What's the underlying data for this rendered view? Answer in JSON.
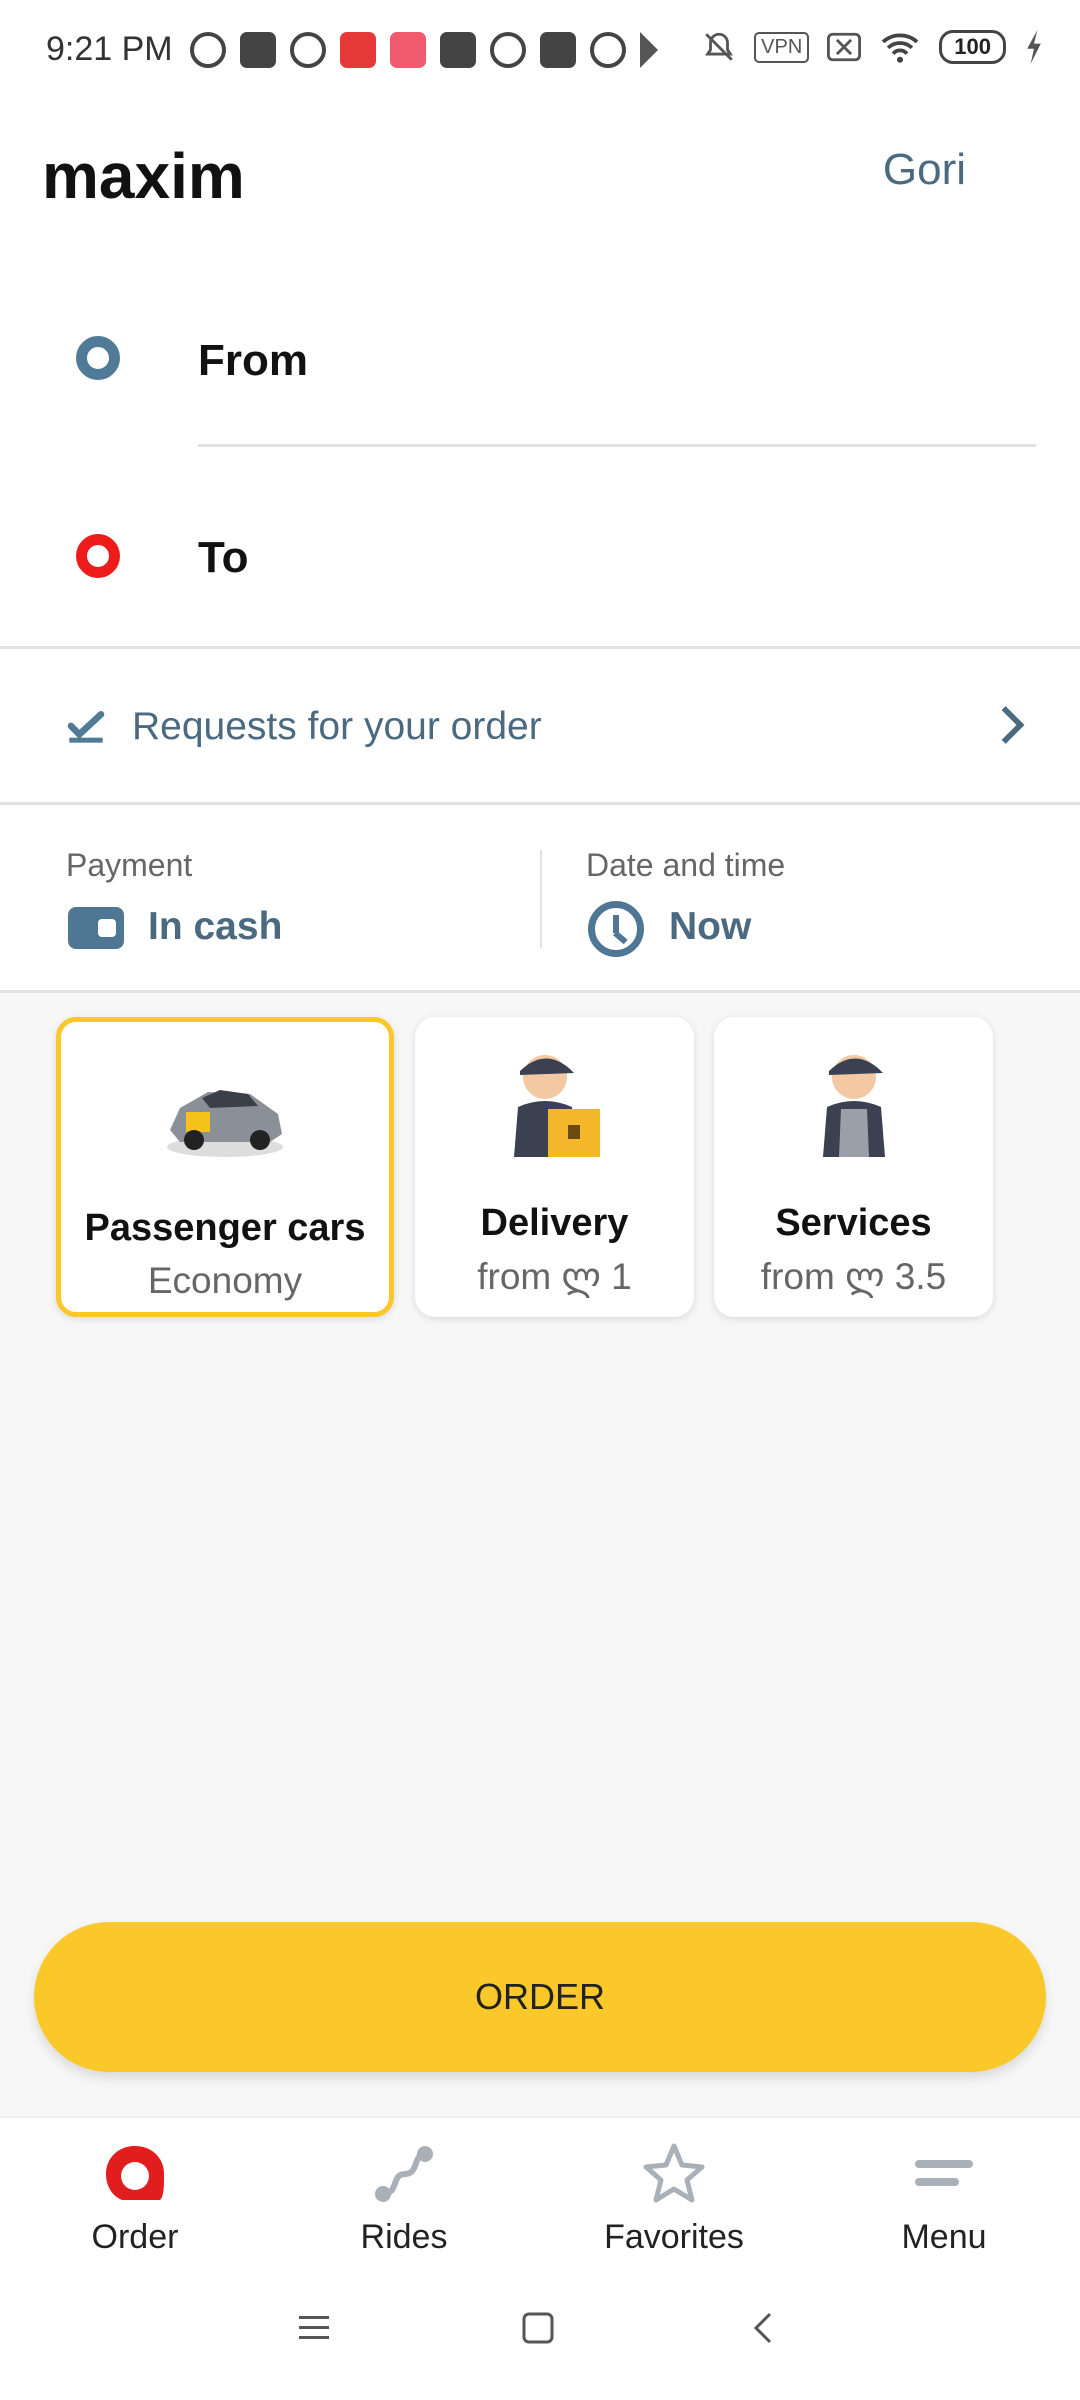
{
  "status_bar": {
    "time": "9:21 PM",
    "vpn": "VPN",
    "battery": "100"
  },
  "header": {
    "brand": "maxim",
    "city": "Gori"
  },
  "route": {
    "from_label": "From",
    "to_label": "To"
  },
  "requests": {
    "label": "Requests for your order"
  },
  "payment": {
    "label": "Payment",
    "value": "In cash"
  },
  "datetime": {
    "label": "Date and time",
    "value": "Now"
  },
  "tariffs": [
    {
      "title": "Passenger cars",
      "subtitle": "Economy",
      "selected": true
    },
    {
      "title": "Delivery",
      "subtitle": "from ლ 1",
      "selected": false
    },
    {
      "title": "Services",
      "subtitle": "from ლ 3.5",
      "selected": false
    }
  ],
  "order_button": {
    "label": "ORDER"
  },
  "bottom_nav": [
    {
      "label": "Order",
      "icon": "order-icon",
      "active": true
    },
    {
      "label": "Rides",
      "icon": "rides-icon",
      "active": false
    },
    {
      "label": "Favorites",
      "icon": "star-icon",
      "active": false
    },
    {
      "label": "Menu",
      "icon": "menu-icon",
      "active": false
    }
  ],
  "colors": {
    "accent_yellow": "#fbc82a",
    "brand_red": "#ee1b1b",
    "text_blue": "#4b6a80",
    "icon_blue": "#507a96"
  }
}
